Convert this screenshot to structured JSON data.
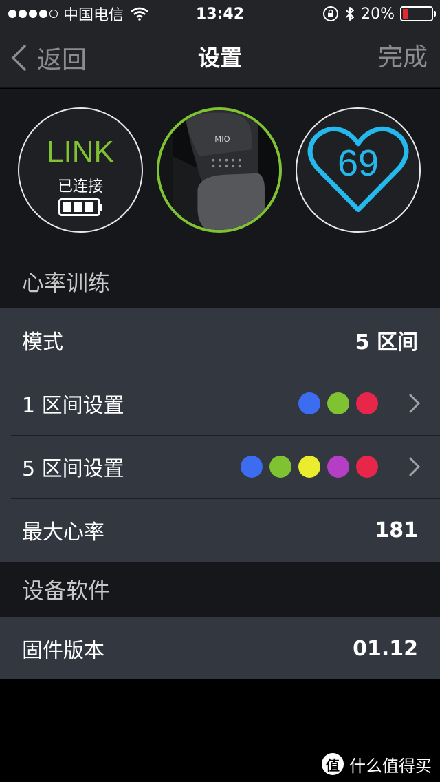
{
  "status_bar": {
    "carrier": "中国电信",
    "time": "13:42",
    "battery_percent": "20%",
    "battery_level": 0.2,
    "battery_color": "#e8262d"
  },
  "nav": {
    "back_label": "返回",
    "title": "设置",
    "done_label": "完成"
  },
  "device": {
    "name": "LINK",
    "status": "已连接",
    "heart_rate": "69",
    "accent_color": "#7fc232",
    "heart_color": "#24b8ec"
  },
  "sections": {
    "training_header": "心率训练",
    "software_header": "设备软件"
  },
  "training": {
    "mode_label": "模式",
    "mode_value": "5 区间",
    "zone1_label": "1 区间设置",
    "zone1_colors": [
      "#3c6cf0",
      "#7fc232",
      "#e8264a"
    ],
    "zone5_label": "5 区间设置",
    "zone5_colors": [
      "#3c6cf0",
      "#7fc232",
      "#ecec2e",
      "#b43ec4",
      "#e8264a"
    ],
    "max_hr_label": "最大心率",
    "max_hr_value": "181"
  },
  "software": {
    "firmware_label": "固件版本",
    "firmware_value": "01.12"
  },
  "watermark": {
    "logo": "值",
    "text": "什么值得买"
  }
}
